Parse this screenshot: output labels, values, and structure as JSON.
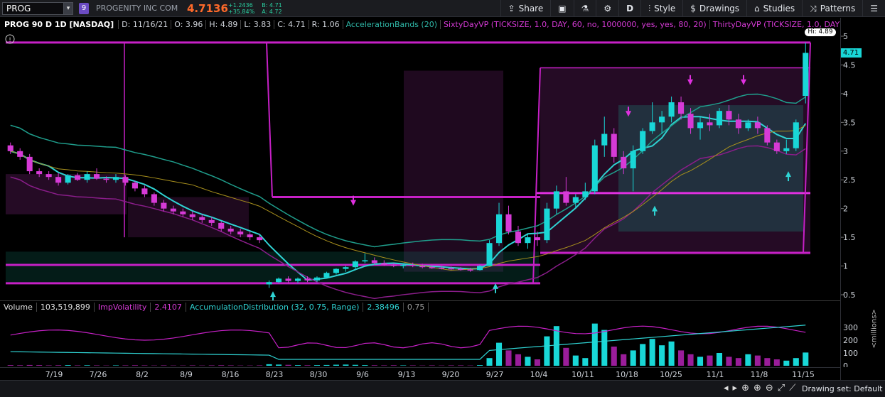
{
  "toolbar": {
    "symbol": "PROG",
    "link_badge": "9",
    "company": "PROGENITY INC COM",
    "last": "4.7136",
    "change": "+1.2436",
    "change_pct": "+35.84%",
    "bid": "B: 4.71",
    "ask": "A: 4.72",
    "share": "Share",
    "period": "D",
    "style": "Style",
    "drawings": "Drawings",
    "studies": "Studies",
    "patterns": "Patterns"
  },
  "chart_header": {
    "symbol": "PROG 90 D 1D [NASDAQ]",
    "date": "D: 11/16/21",
    "open": "O: 3.96",
    "high": "H: 4.89",
    "low": "L: 3.83",
    "close": "C: 4.71",
    "range": "R: 1.06",
    "study1": "AccelerationBands (20)",
    "study2": "SixtyDayVP (TICKSIZE, 1.0, DAY, 60, no, 1000000, yes, yes, 80, 20)",
    "study3": "ThirtyDayVP (TICKSIZE, 1.0, DAY, 30, no, 1000000,..."
  },
  "lower_header": {
    "volume_label": "Volume",
    "volume_value": "103,519,899",
    "impvol_label": "ImpVolatility",
    "impvol_value": "2.4107",
    "acc_label": "AccumulationDistribution (32, 0.75, Range)",
    "acc_value": "2.38496",
    "acc_value2": "0.75"
  },
  "price_axis": [
    "5",
    "4.5",
    "4",
    "3.5",
    "3",
    "2.5",
    "2",
    "1.5",
    "1",
    "0.5"
  ],
  "last_price_tag": "4.71",
  "hi_tag": "Hi: 4.89",
  "volume_axis": [
    "300",
    "200",
    "100",
    "0"
  ],
  "volume_unit": "<millions>",
  "x_axis": [
    "7/19",
    "7/26",
    "8/2",
    "8/9",
    "8/16",
    "8/23",
    "8/30",
    "9/6",
    "9/13",
    "9/20",
    "9/27",
    "10/4",
    "10/11",
    "10/18",
    "10/25",
    "11/1",
    "11/8",
    "11/15"
  ],
  "status": {
    "drawing_set": "Drawing set: Default"
  },
  "colors": {
    "up": "#19d7d7",
    "down": "#d63ad6",
    "accent": "#ff6a2a"
  },
  "chart_data": {
    "type": "candlestick",
    "title": "PROG 90 D 1D [NASDAQ]",
    "ylim": [
      0.5,
      5
    ],
    "candles": [
      [
        3.1,
        3.15,
        2.95,
        3.0
      ],
      [
        3.0,
        3.05,
        2.85,
        2.9
      ],
      [
        2.9,
        2.95,
        2.6,
        2.65
      ],
      [
        2.65,
        2.7,
        2.55,
        2.6
      ],
      [
        2.6,
        2.65,
        2.5,
        2.55
      ],
      [
        2.55,
        2.62,
        2.4,
        2.45
      ],
      [
        2.45,
        2.6,
        2.42,
        2.58
      ],
      [
        2.58,
        2.62,
        2.48,
        2.5
      ],
      [
        2.5,
        2.65,
        2.45,
        2.6
      ],
      [
        2.6,
        2.7,
        2.5,
        2.52
      ],
      [
        2.52,
        2.56,
        2.45,
        2.5
      ],
      [
        2.5,
        2.6,
        2.45,
        2.55
      ],
      [
        2.55,
        2.58,
        2.4,
        2.45
      ],
      [
        2.45,
        2.48,
        2.3,
        2.35
      ],
      [
        2.35,
        2.4,
        2.2,
        2.25
      ],
      [
        2.25,
        2.28,
        2.05,
        2.1
      ],
      [
        2.1,
        2.15,
        1.95,
        2.0
      ],
      [
        2.0,
        2.05,
        1.9,
        1.95
      ],
      [
        1.95,
        2.0,
        1.85,
        1.9
      ],
      [
        1.9,
        1.95,
        1.8,
        1.85
      ],
      [
        1.85,
        1.9,
        1.75,
        1.8
      ],
      [
        1.8,
        1.85,
        1.7,
        1.75
      ],
      [
        1.75,
        1.78,
        1.6,
        1.65
      ],
      [
        1.65,
        1.7,
        1.55,
        1.6
      ],
      [
        1.6,
        1.65,
        1.5,
        1.55
      ],
      [
        1.55,
        1.6,
        1.45,
        1.5
      ],
      [
        1.5,
        1.55,
        1.4,
        1.45
      ],
      [
        0.68,
        0.75,
        0.62,
        0.72
      ],
      [
        0.72,
        0.8,
        0.7,
        0.78
      ],
      [
        0.78,
        0.82,
        0.7,
        0.74
      ],
      [
        0.74,
        0.8,
        0.7,
        0.78
      ],
      [
        0.78,
        0.82,
        0.72,
        0.75
      ],
      [
        0.75,
        0.82,
        0.72,
        0.8
      ],
      [
        0.8,
        0.9,
        0.78,
        0.88
      ],
      [
        0.88,
        0.96,
        0.85,
        0.95
      ],
      [
        0.95,
        1.0,
        0.9,
        0.98
      ],
      [
        0.98,
        1.1,
        0.95,
        1.08
      ],
      [
        1.08,
        1.22,
        1.05,
        1.1
      ],
      [
        1.1,
        1.15,
        1.02,
        1.05
      ],
      [
        1.05,
        1.1,
        1.0,
        1.02
      ],
      [
        1.02,
        1.05,
        0.98,
        1.0
      ],
      [
        1.0,
        1.05,
        0.96,
        1.02
      ],
      [
        1.02,
        1.06,
        0.98,
        1.0
      ],
      [
        1.0,
        1.04,
        0.96,
        0.98
      ],
      [
        0.98,
        1.02,
        0.95,
        0.97
      ],
      [
        0.97,
        1.0,
        0.94,
        0.96
      ],
      [
        0.96,
        0.99,
        0.93,
        0.95
      ],
      [
        0.95,
        0.98,
        0.92,
        0.94
      ],
      [
        0.94,
        0.97,
        0.9,
        0.93
      ],
      [
        0.93,
        1.02,
        0.92,
        1.0
      ],
      [
        1.0,
        1.45,
        1.0,
        1.4
      ],
      [
        1.4,
        2.1,
        1.35,
        1.9
      ],
      [
        1.9,
        2.05,
        1.55,
        1.6
      ],
      [
        1.6,
        1.7,
        1.35,
        1.4
      ],
      [
        1.4,
        1.55,
        1.3,
        1.5
      ],
      [
        1.5,
        1.6,
        1.35,
        1.45
      ],
      [
        1.45,
        2.1,
        1.4,
        2.0
      ],
      [
        2.0,
        2.4,
        1.9,
        2.3
      ],
      [
        2.3,
        2.55,
        2.05,
        2.1
      ],
      [
        2.1,
        2.25,
        2.0,
        2.2
      ],
      [
        2.2,
        2.45,
        2.15,
        2.3
      ],
      [
        2.3,
        3.2,
        2.25,
        3.1
      ],
      [
        3.1,
        3.6,
        2.9,
        3.3
      ],
      [
        3.3,
        3.4,
        2.8,
        2.9
      ],
      [
        2.9,
        3.0,
        2.6,
        2.7
      ],
      [
        2.7,
        3.1,
        2.3,
        3.0
      ],
      [
        3.0,
        3.4,
        2.95,
        3.35
      ],
      [
        3.35,
        3.85,
        3.3,
        3.5
      ],
      [
        3.5,
        3.7,
        3.3,
        3.6
      ],
      [
        3.6,
        3.95,
        3.5,
        3.85
      ],
      [
        3.85,
        3.95,
        3.55,
        3.65
      ],
      [
        3.65,
        3.75,
        3.3,
        3.4
      ],
      [
        3.4,
        3.6,
        3.2,
        3.5
      ],
      [
        3.5,
        3.65,
        3.35,
        3.45
      ],
      [
        3.45,
        3.75,
        3.4,
        3.7
      ],
      [
        3.7,
        3.8,
        3.45,
        3.55
      ],
      [
        3.55,
        3.65,
        3.3,
        3.4
      ],
      [
        3.4,
        3.55,
        3.35,
        3.5
      ],
      [
        3.5,
        3.6,
        3.3,
        3.4
      ],
      [
        3.4,
        3.45,
        3.1,
        3.15
      ],
      [
        3.15,
        3.2,
        2.95,
        3.0
      ],
      [
        3.0,
        3.2,
        2.95,
        3.05
      ],
      [
        3.05,
        3.55,
        3.0,
        3.5
      ],
      [
        3.96,
        4.89,
        3.83,
        4.71
      ]
    ],
    "volume_millions": [
      5,
      4,
      6,
      5,
      3,
      4,
      5,
      3,
      4,
      3,
      2,
      3,
      3,
      4,
      3,
      2,
      3,
      2,
      2,
      3,
      2,
      3,
      4,
      3,
      2,
      2,
      3,
      12,
      9,
      7,
      5,
      4,
      5,
      6,
      8,
      9,
      7,
      5,
      4,
      3,
      4,
      3,
      3,
      2,
      3,
      2,
      3,
      3,
      2,
      5,
      60,
      180,
      120,
      90,
      70,
      50,
      230,
      310,
      140,
      80,
      60,
      330,
      280,
      150,
      90,
      120,
      170,
      210,
      160,
      190,
      120,
      90,
      70,
      80,
      100,
      70,
      60,
      90,
      80,
      60,
      50,
      40,
      60,
      103.5
    ]
  }
}
